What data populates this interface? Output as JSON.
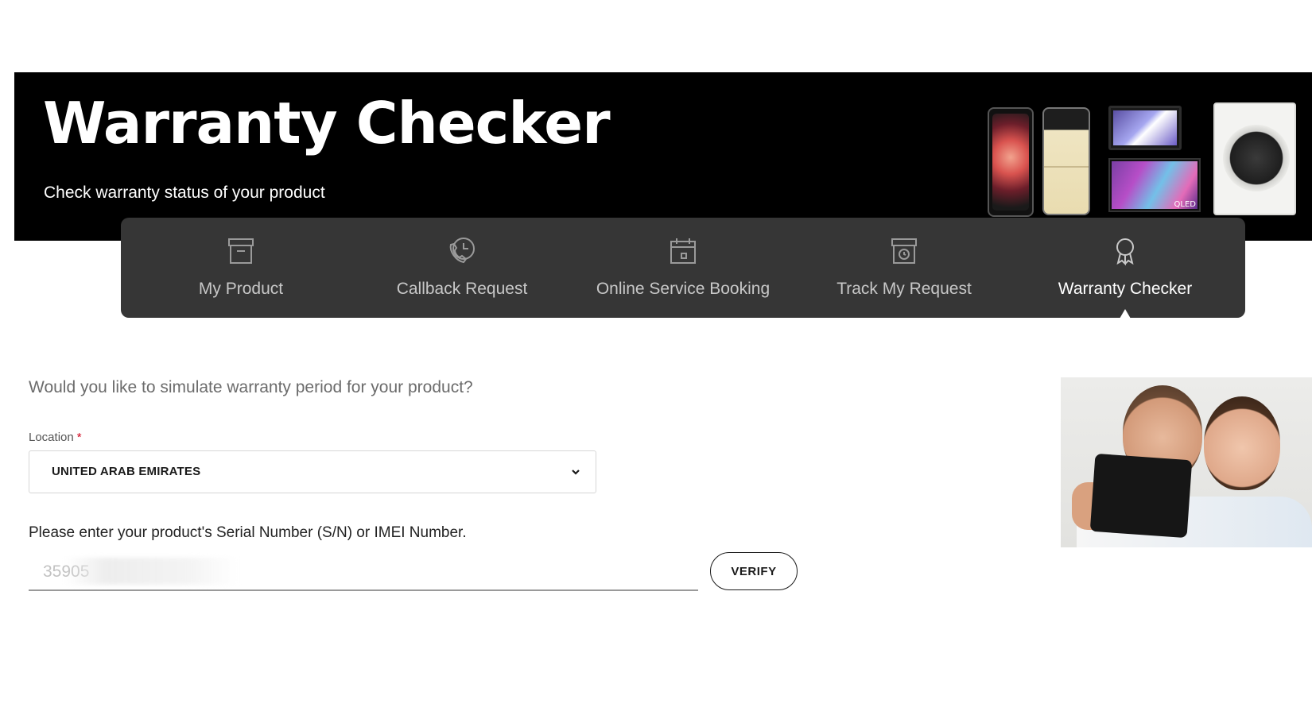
{
  "hero": {
    "title": "Warranty Checker",
    "subtitle": "Check warranty status of your product",
    "tv_badge": "QLED"
  },
  "nav": {
    "items": [
      {
        "label": "My Product",
        "icon": "archive-box-icon",
        "active": false
      },
      {
        "label": "Callback Request",
        "icon": "phone-clock-icon",
        "active": false
      },
      {
        "label": "Online Service Booking",
        "icon": "calendar-icon",
        "active": false
      },
      {
        "label": "Track My Request",
        "icon": "box-clock-icon",
        "active": false
      },
      {
        "label": "Warranty Checker",
        "icon": "award-ribbon-icon",
        "active": true
      }
    ]
  },
  "form": {
    "question": "Would you like to simulate warranty period for your product?",
    "location_label": "Location",
    "location_required_mark": "*",
    "location_value": "UNITED ARAB EMIRATES",
    "serial_prompt": "Please enter your product's Serial Number (S/N) or IMEI Number.",
    "serial_value": "35905",
    "verify_label": "VERIFY"
  },
  "colors": {
    "hero_bg": "#000000",
    "nav_bg": "#363636",
    "required": "#d0021b"
  }
}
